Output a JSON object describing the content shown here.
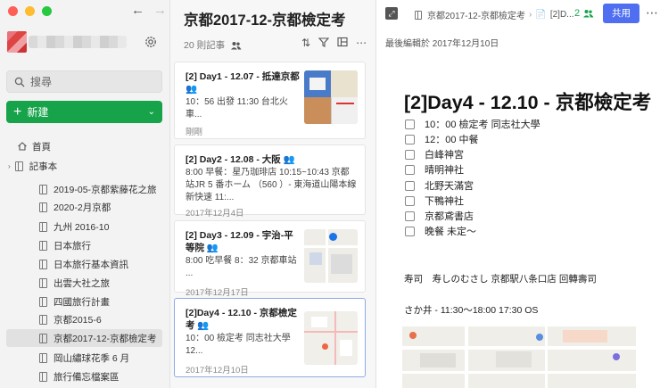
{
  "sidebar": {
    "search_label": "搜尋",
    "new_label": "新建",
    "home_label": "首頁",
    "notebooks_label": "記事本",
    "notebooks": [
      "2019-05-京都紫藤花之旅",
      "2020-2月京都",
      "九州 2016-10",
      "日本旅行",
      "日本旅行基本資訊",
      "出雲大社之旅",
      "四國旅行計畫",
      "京都2015-6",
      "京都2017-12-京都檢定考",
      "岡山繡球花季 6 月",
      "旅行備忘檔案區"
    ]
  },
  "notelist": {
    "title": "京都2017-12-京都檢定考",
    "count": "20 則記事",
    "notes": [
      {
        "title": "[2] Day1 - 12.07 - 抵達京都",
        "body": "10：56 出發 11:30 台北火車...",
        "date": "剛剛",
        "shared": true
      },
      {
        "title": "[2] Day2 - 12.08 - 大阪",
        "body": "8:00 早餐：星乃珈琲店 10:15~10:43 京都站JR 5 番ホーム （560 ）- 東海道山陽本線新快速 11:...",
        "date": "2017年12月4日",
        "shared": true
      },
      {
        "title": "[2] Day3 - 12.09 - 宇治-平等院",
        "body": "8:00 吃早餐 8：32 京都車站 ...",
        "date": "2017年12月17日",
        "shared": true
      },
      {
        "title": "[2]Day4 - 12.10 - 京都檢定考",
        "body": "10：00 檢定考 同志社大學 12...",
        "date": "2017年12月10日",
        "shared": true
      }
    ]
  },
  "editor": {
    "breadcrumb_notebook": "京都2017-12-京都檢定考",
    "breadcrumb_note": "[2]D...",
    "share_count": "2",
    "share_button": "共用",
    "last_edited": "最後編輯於 2017年12月10日",
    "title": "[2]Day4 - 12.10 - 京都檢定考",
    "todos": [
      "10：00 檢定考 同志社大學",
      "12：00 中餐",
      "白峰神宮",
      "晴明神社",
      "北野天滿宮",
      "下鴨神社",
      "京都鳶書店",
      "晚餐 未定～"
    ],
    "para1": "寿司　寿しのむさし 京都駅八条口店 回轉壽司",
    "para2": "さか井 - 11:30～18:00 17:30 OS"
  },
  "colors": {
    "accent_green": "#16a34a",
    "share_blue": "#4f6ff0"
  }
}
